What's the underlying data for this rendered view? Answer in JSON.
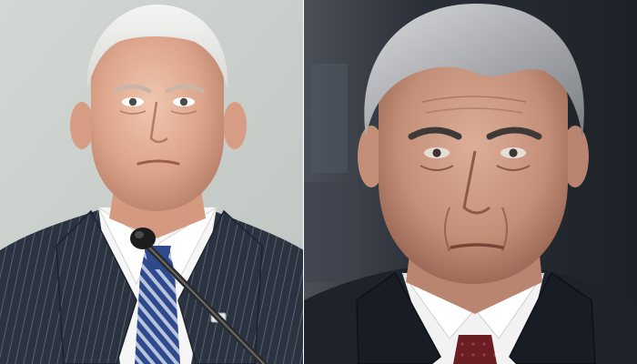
{
  "image": {
    "layout": "side-by-side",
    "panel_count": 2,
    "panels": [
      {
        "name": "left-photo",
        "subject": "portrait-man-white-hair",
        "background_color": "#c9cecb",
        "suit_color": "#2b3340",
        "shirt_color": "#ffffff",
        "tie_color": "#2e4a8c"
      },
      {
        "name": "right-photo",
        "subject": "portrait-man-gray-hair",
        "background_color": "#2a2e36",
        "suit_color": "#1e222b",
        "shirt_color": "#f2f2f2",
        "tie_color": "#6a1e24"
      }
    ],
    "divider_color": "#ffffff",
    "objects": [
      "microphone",
      "lapel-pin"
    ]
  }
}
